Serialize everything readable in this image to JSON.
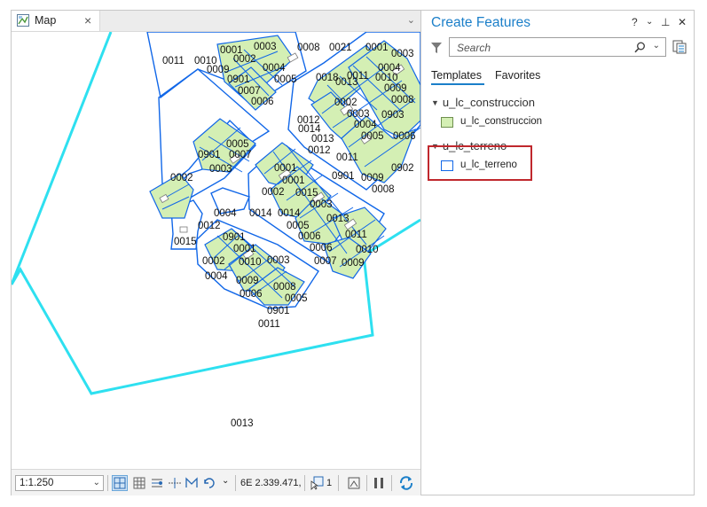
{
  "map": {
    "tab_label": "Map",
    "tab_close": "×",
    "tab_overflow": "⌄",
    "parcel_labels": [
      {
        "t": "0011"
      },
      {
        "t": "0010"
      },
      {
        "t": "0001"
      },
      {
        "t": "0003"
      },
      {
        "t": "0002"
      },
      {
        "t": "0009"
      },
      {
        "t": "0004"
      },
      {
        "t": "0901"
      },
      {
        "t": "0005"
      },
      {
        "t": "0007"
      },
      {
        "t": "0006"
      },
      {
        "t": "0008"
      },
      {
        "t": "0021"
      },
      {
        "t": "0001"
      },
      {
        "t": "0003"
      },
      {
        "t": "0018"
      },
      {
        "t": "0013"
      },
      {
        "t": "0011"
      },
      {
        "t": "0004"
      },
      {
        "t": "0010"
      },
      {
        "t": "0009"
      },
      {
        "t": "0008"
      },
      {
        "t": "0002"
      },
      {
        "t": "0012"
      },
      {
        "t": "0003"
      },
      {
        "t": "0903"
      },
      {
        "t": "0014"
      },
      {
        "t": "0004"
      },
      {
        "t": "0013"
      },
      {
        "t": "0005"
      },
      {
        "t": "0006"
      },
      {
        "t": "0012"
      },
      {
        "t": "0011"
      },
      {
        "t": "0902"
      },
      {
        "t": "0901"
      },
      {
        "t": "0009"
      },
      {
        "t": "0008"
      },
      {
        "t": "0005"
      },
      {
        "t": "0007"
      },
      {
        "t": "0901"
      },
      {
        "t": "0003"
      },
      {
        "t": "0002"
      },
      {
        "t": "0001"
      },
      {
        "t": "0001"
      },
      {
        "t": "0002"
      },
      {
        "t": "0015"
      },
      {
        "t": "0003"
      },
      {
        "t": "0004"
      },
      {
        "t": "0014"
      },
      {
        "t": "0014"
      },
      {
        "t": "0013"
      },
      {
        "t": "0005"
      },
      {
        "t": "0012"
      },
      {
        "t": "0015"
      },
      {
        "t": "0006"
      },
      {
        "t": "0011"
      },
      {
        "t": "0006"
      },
      {
        "t": "0010"
      },
      {
        "t": "0007"
      },
      {
        "t": "0009"
      },
      {
        "t": "0901"
      },
      {
        "t": "0001"
      },
      {
        "t": "0002"
      },
      {
        "t": "0010"
      },
      {
        "t": "0003"
      },
      {
        "t": "0004"
      },
      {
        "t": "0009"
      },
      {
        "t": "0008"
      },
      {
        "t": "0005"
      },
      {
        "t": "0006"
      },
      {
        "t": "0901"
      },
      {
        "t": "0011"
      },
      {
        "t": "0013"
      },
      {
        "t": "0001"
      }
    ]
  },
  "statusbar": {
    "scale": "1:1.250",
    "scale_chevron": "⌄",
    "more_chevron": "⌄",
    "coordinates": "6E 2.339.471,",
    "selected_count": "1"
  },
  "create_features": {
    "title": "Create Features",
    "help": "?",
    "menu": "⌄",
    "pin": "⊥",
    "close": "✕",
    "search_placeholder": "Search",
    "search_chevron": "⌄",
    "tabs": [
      {
        "label": "Templates"
      },
      {
        "label": "Favorites"
      }
    ],
    "groups": [
      {
        "name": "u_lc_construccion",
        "items": [
          {
            "label": "u_lc_construccion"
          }
        ]
      },
      {
        "name": "u_lc_terreno",
        "items": [
          {
            "label": "u_lc_terreno"
          }
        ]
      }
    ],
    "colors": {
      "accent": "#1b7fc9",
      "highlight": "#c0282d",
      "parcel_outline": "#1167e8",
      "boundary": "#2ee0f0",
      "building_fill": "#d4efb4"
    }
  }
}
